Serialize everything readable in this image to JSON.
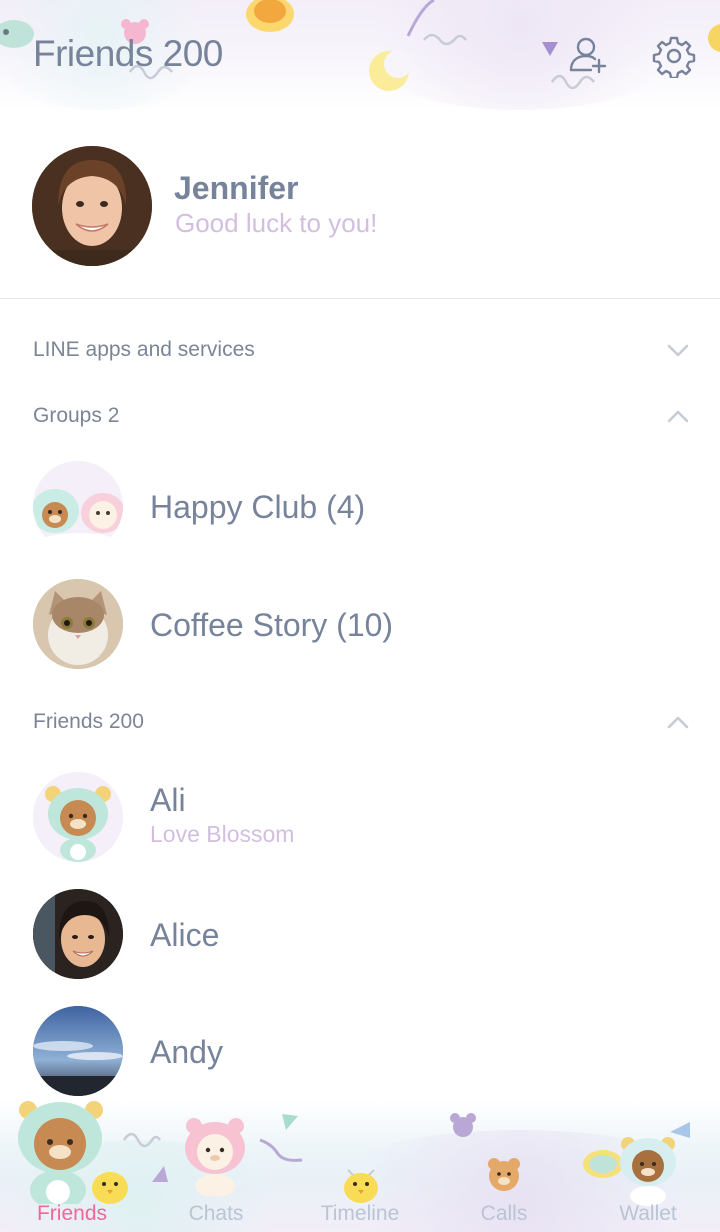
{
  "header": {
    "title": "Friends 200",
    "add_friend_icon": "add-friend-icon",
    "settings_icon": "gear-icon"
  },
  "profile": {
    "name": "Jennifer",
    "status": "Good luck to you!"
  },
  "sections": {
    "services": {
      "label": "LINE apps and services",
      "expanded": false
    },
    "groups": {
      "label": "Groups 2",
      "expanded": true,
      "items": [
        {
          "name": "Happy Club (4)"
        },
        {
          "name": "Coffee Story (10)"
        }
      ]
    },
    "friends": {
      "label": "Friends 200",
      "expanded": true,
      "items": [
        {
          "name": "Ali",
          "status": "Love Blossom"
        },
        {
          "name": "Alice"
        },
        {
          "name": "Andy"
        }
      ]
    }
  },
  "tabs": [
    {
      "label": "Friends",
      "active": true
    },
    {
      "label": "Chats",
      "active": false
    },
    {
      "label": "Timeline",
      "active": false
    },
    {
      "label": "Calls",
      "active": false
    },
    {
      "label": "Wallet",
      "active": false
    }
  ],
  "colors": {
    "text": "#77839a",
    "status": "#d2bfe0",
    "active_tab": "#f0679a",
    "inactive_tab": "#b9c4d4"
  }
}
